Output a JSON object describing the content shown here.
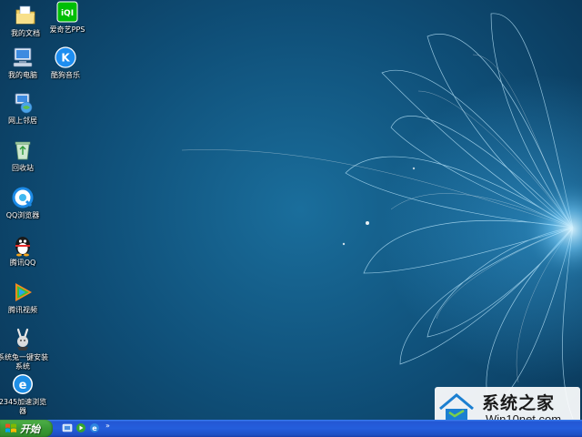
{
  "desktop": {
    "icons": [
      {
        "name": "my-documents",
        "label": "我的文档"
      },
      {
        "name": "iqiyi",
        "label": "爱奇艺PPS"
      },
      {
        "name": "my-computer",
        "label": "我的电脑"
      },
      {
        "name": "kugou-music",
        "label": "酷狗音乐"
      },
      {
        "name": "network-neighborhood",
        "label": "网上邻居"
      },
      {
        "name": "recycle-bin",
        "label": "回收站"
      },
      {
        "name": "qq-browser",
        "label": "QQ浏览器"
      },
      {
        "name": "tencent-qq",
        "label": "腾讯QQ"
      },
      {
        "name": "tencent-video",
        "label": "腾讯视频"
      },
      {
        "name": "system-installer",
        "label": "系统兔一键安装系统"
      },
      {
        "name": "2345-browser",
        "label": "2345加速浏览器"
      }
    ]
  },
  "watermark": {
    "title": "系统之家",
    "url": "Win10net.com"
  },
  "taskbar": {
    "start_label": "开始",
    "quick_launch_more": "»"
  },
  "colors": {
    "taskbar": "#245edc",
    "start_button": "#3a9a35",
    "wallpaper_dark": "#0a3758",
    "wallpaper_light": "#1a6e9c"
  }
}
